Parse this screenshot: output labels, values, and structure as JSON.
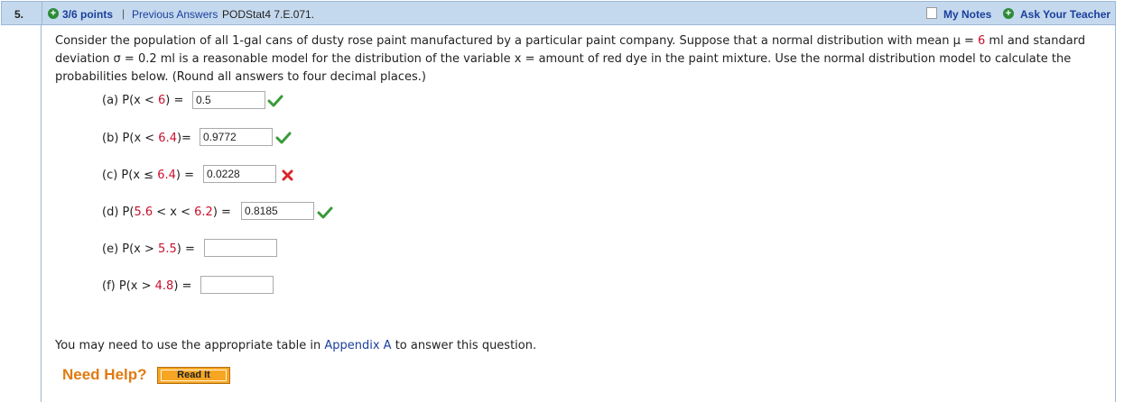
{
  "header": {
    "number": "5.",
    "points": "3/6 points",
    "separator": "|",
    "previous_answers": "Previous Answers",
    "code": "PODStat4 7.E.071.",
    "my_notes": "My Notes",
    "ask_teacher": "Ask Your Teacher"
  },
  "stem": {
    "p1": "Consider the population of all 1-gal cans of dusty rose paint manufactured by a particular paint company. Suppose that a normal distribution with mean μ = ",
    "mean": "6",
    "p2": " ml and standard deviation σ = 0.2 ml is a reasonable model for the distribution of the variable x = amount of red dye in the paint mixture. Use the normal distribution model to calculate the probabilities below. (Round all answers to four decimal places.)"
  },
  "parts": [
    {
      "pre": "(a) P(x < ",
      "num": "6",
      "post": ") = ",
      "value": "0.5",
      "status": "correct"
    },
    {
      "pre": "(b) P(x < ",
      "num": "6.4",
      "post": ")= ",
      "value": "0.9772",
      "status": "correct"
    },
    {
      "pre": "(c) P(x ≤ ",
      "num": "6.4",
      "post": ") = ",
      "value": "0.0228",
      "status": "incorrect"
    },
    {
      "pre": "(d) P(",
      "num": "5.6",
      "mid": " < x < ",
      "num2": "6.2",
      "post": ") = ",
      "value": "0.8185",
      "status": "correct"
    },
    {
      "pre": "(e) P(x > ",
      "num": "5.5",
      "post": ") = ",
      "value": "",
      "status": "blank"
    },
    {
      "pre": "(f) P(x > ",
      "num": "4.8",
      "post": ") = ",
      "value": "",
      "status": "blank"
    }
  ],
  "note": {
    "pre": "You may need to use the appropriate table in ",
    "link": "Appendix A",
    "post": " to answer this question."
  },
  "help": {
    "label": "Need Help?",
    "button": "Read It"
  },
  "colors": {
    "header_bg": "#c5d9ee",
    "link": "#1a3e9b",
    "value_red": "#c8102e",
    "check_green": "#3a9a3a",
    "x_red": "#d9262c",
    "help_orange": "#e07b10",
    "button_orange": "#f6a623"
  }
}
